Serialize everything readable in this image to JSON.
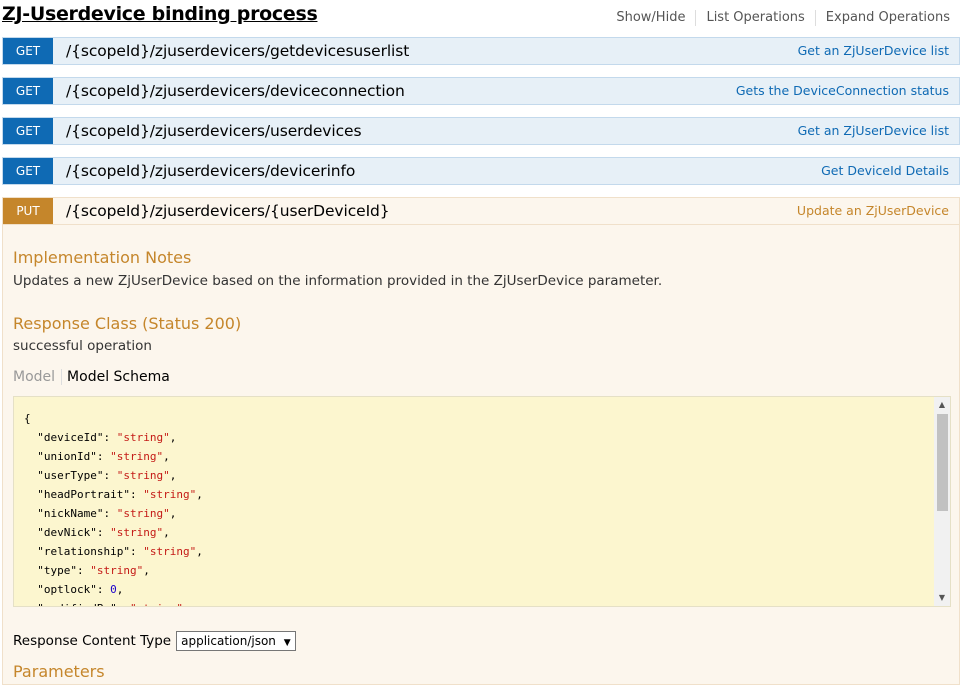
{
  "header": {
    "title": "ZJ-Userdevice binding process",
    "links": [
      "Show/Hide",
      "List Operations",
      "Expand Operations"
    ]
  },
  "operations": [
    {
      "method": "GET",
      "path": "/{scopeId}/zjuserdevicers/getdevicesuserlist",
      "summary": "Get an ZjUserDevice list"
    },
    {
      "method": "GET",
      "path": "/{scopeId}/zjuserdevicers/deviceconnection",
      "summary": "Gets the DeviceConnection status"
    },
    {
      "method": "GET",
      "path": "/{scopeId}/zjuserdevicers/userdevices",
      "summary": "Get an ZjUserDevice list"
    },
    {
      "method": "GET",
      "path": "/{scopeId}/zjuserdevicers/devicerinfo",
      "summary": "Get DeviceId Details"
    },
    {
      "method": "PUT",
      "path": "/{scopeId}/zjuserdevicers/{userDeviceId}",
      "summary": "Update an ZjUserDevice"
    }
  ],
  "details": {
    "impl_title": "Implementation Notes",
    "impl_text": "Updates a new ZjUserDevice based on the information provided in the ZjUserDevice parameter.",
    "resp_title": "Response Class (Status 200)",
    "resp_text": "successful operation",
    "tab_model": "Model",
    "tab_schema": "Model Schema",
    "schema_lines": [
      {
        "key": "",
        "val": "{",
        "type": "brace"
      },
      {
        "key": "\"deviceId\"",
        "val": "\"string\"",
        "type": "s"
      },
      {
        "key": "\"unionId\"",
        "val": "\"string\"",
        "type": "s"
      },
      {
        "key": "\"userType\"",
        "val": "\"string\"",
        "type": "s"
      },
      {
        "key": "\"headPortrait\"",
        "val": "\"string\"",
        "type": "s"
      },
      {
        "key": "\"nickName\"",
        "val": "\"string\"",
        "type": "s"
      },
      {
        "key": "\"devNick\"",
        "val": "\"string\"",
        "type": "s"
      },
      {
        "key": "\"relationship\"",
        "val": "\"string\"",
        "type": "s"
      },
      {
        "key": "\"type\"",
        "val": "\"string\"",
        "type": "s"
      },
      {
        "key": "\"optlock\"",
        "val": "0",
        "type": "n"
      },
      {
        "key": "\"modifiedBy\"",
        "val": "\"string\"",
        "type": "s"
      }
    ],
    "content_type_label": "Response Content Type",
    "content_type_value": "application/json",
    "params_title": "Parameters"
  },
  "colors": {
    "get": "#0f6ab4",
    "put": "#c5862b"
  }
}
